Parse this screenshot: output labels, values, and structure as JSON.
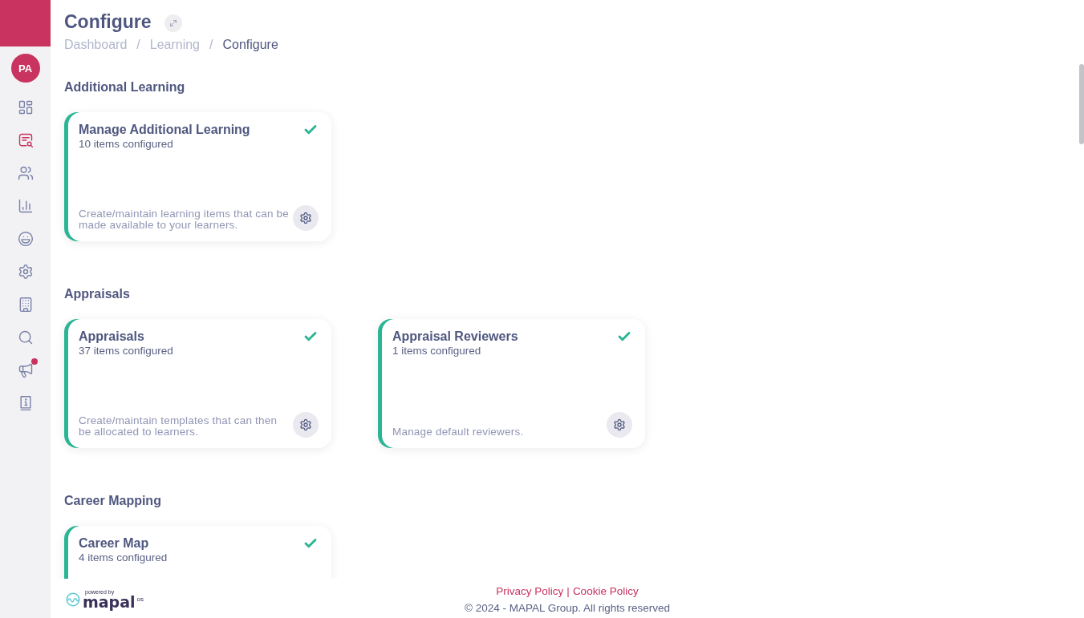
{
  "sidebar": {
    "avatar": {
      "initials": "PA"
    },
    "items": [
      {
        "selected": false,
        "notification": false
      },
      {
        "selected": true,
        "notification": false
      },
      {
        "selected": false,
        "notification": false
      },
      {
        "selected": false,
        "notification": false
      },
      {
        "selected": false,
        "notification": false
      },
      {
        "selected": false,
        "notification": false
      },
      {
        "selected": false,
        "notification": false
      },
      {
        "selected": false,
        "notification": false
      },
      {
        "selected": false,
        "notification": true
      },
      {
        "selected": false,
        "notification": false
      }
    ]
  },
  "header": {
    "title": "Configure",
    "breadcrumb": [
      {
        "label": "Dashboard",
        "current": false,
        "separator": "/"
      },
      {
        "label": "Learning",
        "current": false,
        "separator": "/"
      },
      {
        "label": "Configure",
        "current": true
      }
    ]
  },
  "sections": [
    {
      "heading": "Additional Learning",
      "cards": [
        {
          "title": "Manage Additional Learning",
          "count": "10 items configured",
          "description": "Create/maintain learning items that can be made available to your learners.",
          "configured": true
        }
      ]
    },
    {
      "heading": "Appraisals",
      "cards": [
        {
          "title": "Appraisals",
          "count": "37 items configured",
          "description": "Create/maintain templates that can then be allocated to learners.",
          "configured": true
        },
        {
          "title": "Appraisal Reviewers",
          "count": "1 items configured",
          "description": "Manage default reviewers.",
          "configured": true
        }
      ]
    },
    {
      "heading": "Career Mapping",
      "cards": [
        {
          "title": "Career Map",
          "count": "4 items configured",
          "configured": true
        }
      ]
    }
  ],
  "footer": {
    "powered_by": {
      "caption": "powered by",
      "wordmark": "mapal",
      "suffix": "os"
    },
    "links": [
      "Privacy Policy",
      "Cookie Policy"
    ],
    "link_separator": "|",
    "copyright": "© 2024 - MAPAL Group. All rights reserved"
  }
}
